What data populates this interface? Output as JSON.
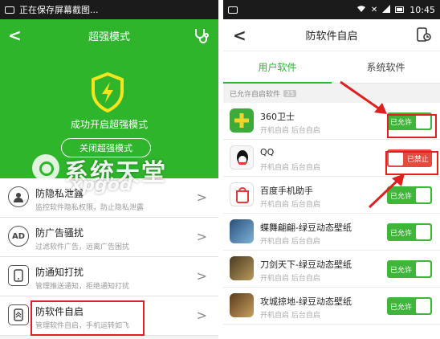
{
  "left": {
    "status_text": "正在保存屏幕截图...",
    "title": "超强模式",
    "success_message": "成功开启超强模式",
    "close_button_label": "关闭超强模式",
    "watermark_text": "系统天堂",
    "watermark_sub": "xpgod",
    "menu": [
      {
        "title": "防隐私泄露",
        "subtitle": "监控软件隐私权限，防止隐私泄露",
        "icon": "person-icon"
      },
      {
        "title": "防广告骚扰",
        "subtitle": "过滤软件广告，远离广告困扰",
        "icon": "ad-icon"
      },
      {
        "title": "防通知打扰",
        "subtitle": "管理推送通知，拒绝通知打扰",
        "icon": "phone-icon"
      },
      {
        "title": "防软件自启",
        "subtitle": "管理软件自启，手机运转如飞",
        "icon": "startup-icon"
      }
    ]
  },
  "right": {
    "time": "10:45",
    "title": "防软件自启",
    "tabs": [
      "用户软件",
      "系统软件"
    ],
    "section_label": "已允许自启软件",
    "section_count": "25",
    "apps": [
      {
        "name": "360卫士",
        "sub": "开机自启 后台自启",
        "toggle": "已允许",
        "state": "on",
        "icon_color": "#3cab3a"
      },
      {
        "name": "QQ",
        "sub": "开机自启 后台自启",
        "toggle": "已禁止",
        "state": "off",
        "icon_color": "#111111"
      },
      {
        "name": "百度手机助手",
        "sub": "开机自启 后台自启",
        "toggle": "已允许",
        "state": "on",
        "icon_color": "#e23a3a"
      },
      {
        "name": "蝶舞翩翩-绿豆动态壁纸",
        "sub": "开机自启 后台自启",
        "toggle": "已允许",
        "state": "on",
        "icon_color": "#4a7fb0"
      },
      {
        "name": "刀剑天下-绿豆动态壁纸",
        "sub": "开机自启 后台自启",
        "toggle": "已允许",
        "state": "on",
        "icon_color": "#8a6a3a"
      },
      {
        "name": "攻城掠地-绿豆动态壁纸",
        "sub": "开机自启 后台自启",
        "toggle": "已允许",
        "state": "on",
        "icon_color": "#7a5a2a"
      }
    ]
  }
}
